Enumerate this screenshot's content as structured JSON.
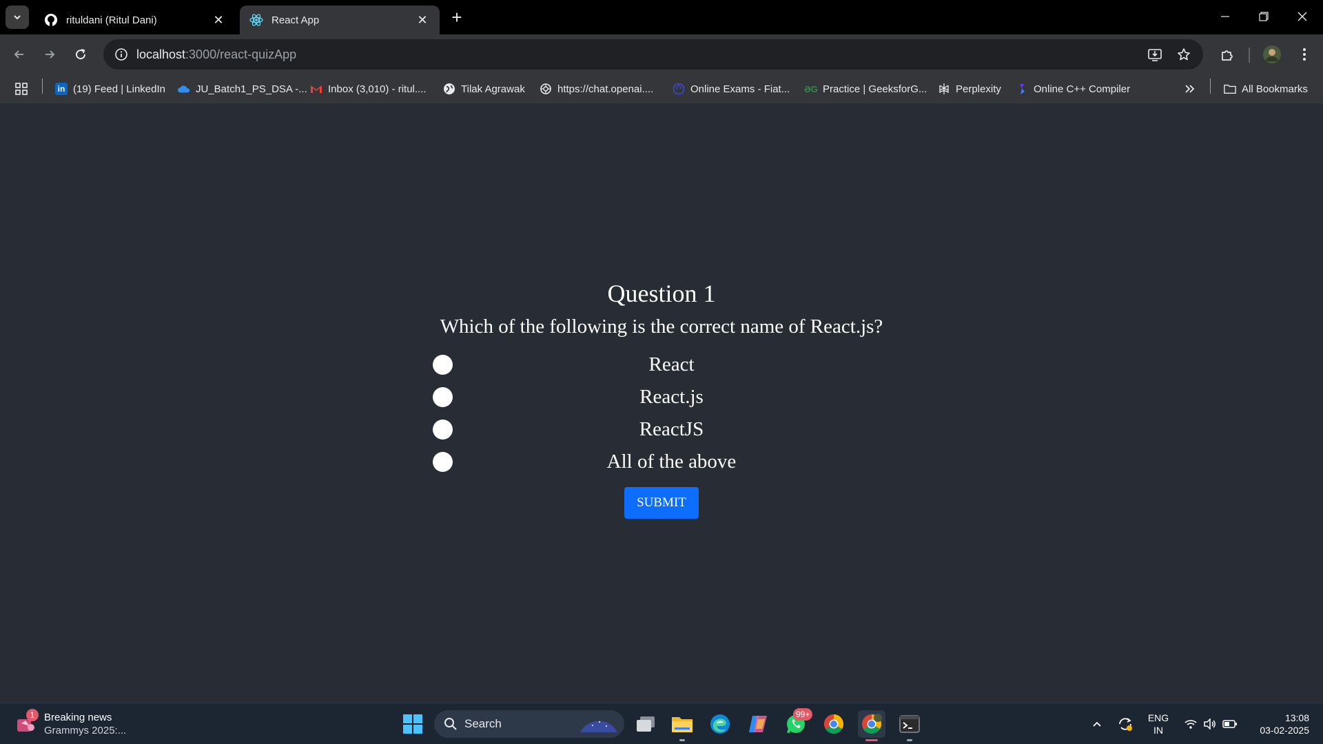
{
  "browser": {
    "tabs": [
      {
        "title": "rituldani (Ritul Dani)",
        "favicon": "github-icon",
        "active": false
      },
      {
        "title": "React App",
        "favicon": "react-icon",
        "active": true
      }
    ],
    "address": {
      "host": "localhost",
      "path": ":3000/react-quizApp"
    },
    "bookmarks": [
      {
        "label": "(19) Feed | LinkedIn",
        "icon": "linkedin-icon"
      },
      {
        "label": "JU_Batch1_PS_DSA -...",
        "icon": "onedrive-icon"
      },
      {
        "label": "Inbox (3,010) - ritul....",
        "icon": "gmail-icon"
      },
      {
        "label": "Tilak Agrawak",
        "icon": "globe-icon"
      },
      {
        "label": "https://chat.openai....",
        "icon": "openai-icon"
      },
      {
        "label": "Online Exams - Fiat...",
        "icon": "exam-icon"
      },
      {
        "label": "Practice | GeeksforG...",
        "icon": "geeksforgeeks-icon"
      },
      {
        "label": "Perplexity",
        "icon": "perplexity-icon"
      },
      {
        "label": "Online C++ Compiler",
        "icon": "compiler-icon"
      }
    ],
    "all_bookmarks_label": "All Bookmarks",
    "colors": {
      "tab_active": "#35363a",
      "tabstrip": "#000000",
      "omnibox": "#202124"
    }
  },
  "quiz": {
    "question_title": "Question 1",
    "question_text": "Which of the following is the correct name of React.js?",
    "options": [
      "React",
      "React.js",
      "ReactJS",
      "All of the above"
    ],
    "submit_label": "SUBMIT",
    "colors": {
      "background": "#282c34",
      "submit": "#0d6efd"
    }
  },
  "taskbar": {
    "news_title": "Breaking news",
    "news_subtitle": "Grammys 2025:...",
    "news_badge": "1",
    "search_label": "Search",
    "whatsapp_badge": "99+",
    "language": "ENG",
    "region": "IN",
    "time": "13:08",
    "date": "03-02-2025"
  }
}
